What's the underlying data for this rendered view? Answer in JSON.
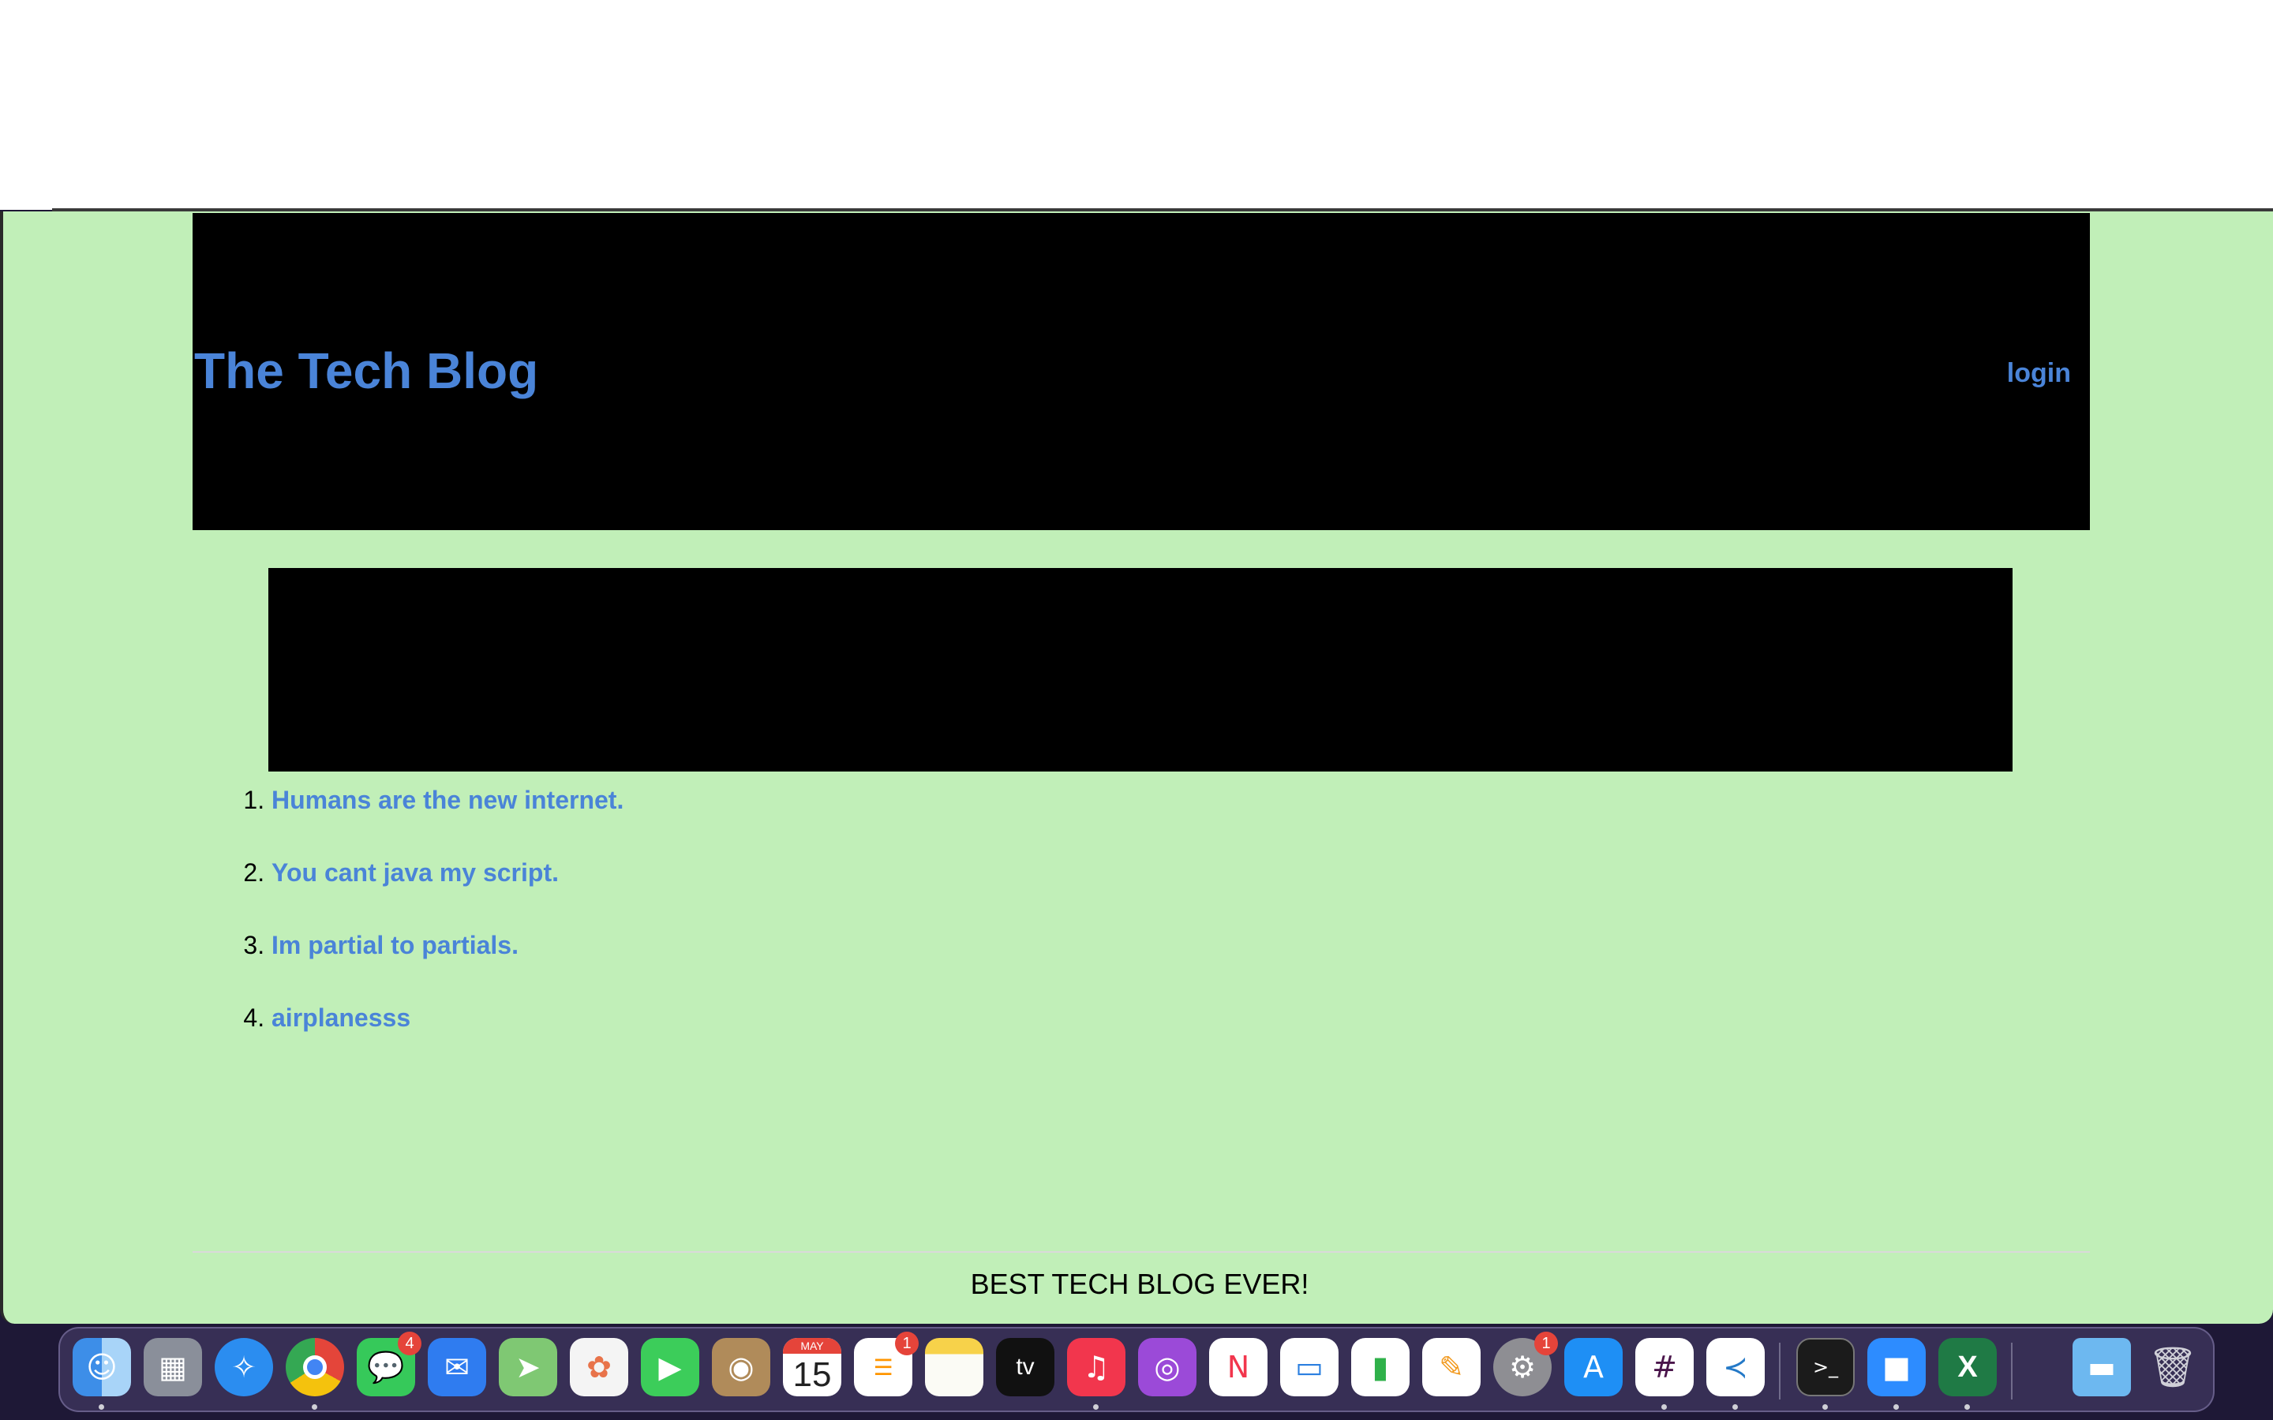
{
  "site": {
    "title": "The Tech Blog",
    "login_label": "login"
  },
  "posts": [
    {
      "title": "Humans are the new internet."
    },
    {
      "title": "You cant java my script."
    },
    {
      "title": "Im partial to partials."
    },
    {
      "title": "airplanesss"
    }
  ],
  "footer": {
    "text": "BEST TECH BLOG EVER!"
  },
  "colors": {
    "page_background": "#c1efb8",
    "link": "#4a84d8",
    "header_background": "#000000"
  },
  "dock": {
    "items": [
      {
        "name": "finder-icon",
        "running": true
      },
      {
        "name": "launchpad-icon",
        "running": false
      },
      {
        "name": "safari-icon",
        "running": false
      },
      {
        "name": "chrome-icon",
        "running": true
      },
      {
        "name": "messages-icon",
        "running": false,
        "badge": "4"
      },
      {
        "name": "mail-icon",
        "running": false
      },
      {
        "name": "maps-icon",
        "running": false
      },
      {
        "name": "photos-icon",
        "running": false
      },
      {
        "name": "facetime-icon",
        "running": false
      },
      {
        "name": "contacts-icon",
        "running": false
      },
      {
        "name": "calendar-icon",
        "running": false,
        "month": "MAY",
        "day": "15"
      },
      {
        "name": "reminders-icon",
        "running": false,
        "badge": "1"
      },
      {
        "name": "notes-icon",
        "running": false
      },
      {
        "name": "apple-tv-icon",
        "running": false,
        "label": "tv"
      },
      {
        "name": "music-icon",
        "running": true
      },
      {
        "name": "podcasts-icon",
        "running": false
      },
      {
        "name": "news-icon",
        "running": false
      },
      {
        "name": "keynote-icon",
        "running": false
      },
      {
        "name": "numbers-icon",
        "running": false
      },
      {
        "name": "pages-icon",
        "running": false
      },
      {
        "name": "system-settings-icon",
        "running": false,
        "badge": "1"
      },
      {
        "name": "app-store-icon",
        "running": false
      },
      {
        "name": "slack-icon",
        "running": true
      },
      {
        "name": "vscode-icon",
        "running": true
      },
      {
        "name": "terminal-icon",
        "running": true
      },
      {
        "name": "zoom-icon",
        "running": true
      },
      {
        "name": "excel-icon",
        "running": true
      },
      {
        "name": "downloads-folder-icon",
        "running": false
      },
      {
        "name": "trash-icon",
        "running": false
      }
    ]
  }
}
